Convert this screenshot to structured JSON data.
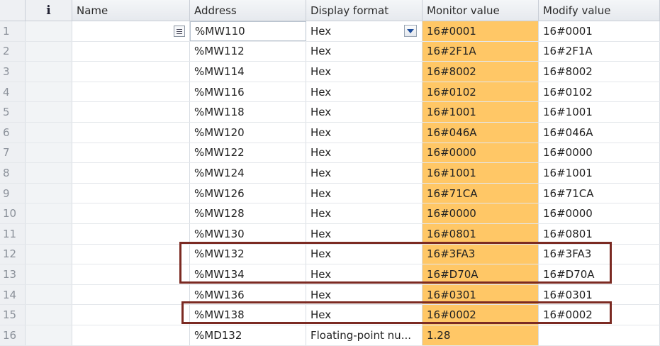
{
  "columns": {
    "info": "i",
    "name": "Name",
    "address": "Address",
    "display_format": "Display format",
    "monitor_value": "Monitor value",
    "modify_value": "Modify value"
  },
  "rows": [
    {
      "num": "1",
      "name": "",
      "address": "%MW110",
      "format": "Hex",
      "monitor": "16#0001",
      "modify": "16#0001"
    },
    {
      "num": "2",
      "name": "",
      "address": "%MW112",
      "format": "Hex",
      "monitor": "16#2F1A",
      "modify": "16#2F1A"
    },
    {
      "num": "3",
      "name": "",
      "address": "%MW114",
      "format": "Hex",
      "monitor": "16#8002",
      "modify": "16#8002"
    },
    {
      "num": "4",
      "name": "",
      "address": "%MW116",
      "format": "Hex",
      "monitor": "16#0102",
      "modify": "16#0102"
    },
    {
      "num": "5",
      "name": "",
      "address": "%MW118",
      "format": "Hex",
      "monitor": "16#1001",
      "modify": "16#1001"
    },
    {
      "num": "6",
      "name": "",
      "address": "%MW120",
      "format": "Hex",
      "monitor": "16#046A",
      "modify": "16#046A"
    },
    {
      "num": "7",
      "name": "",
      "address": "%MW122",
      "format": "Hex",
      "monitor": "16#0000",
      "modify": "16#0000"
    },
    {
      "num": "8",
      "name": "",
      "address": "%MW124",
      "format": "Hex",
      "monitor": "16#1001",
      "modify": "16#1001"
    },
    {
      "num": "9",
      "name": "",
      "address": "%MW126",
      "format": "Hex",
      "monitor": "16#71CA",
      "modify": "16#71CA"
    },
    {
      "num": "10",
      "name": "",
      "address": "%MW128",
      "format": "Hex",
      "monitor": "16#0000",
      "modify": "16#0000"
    },
    {
      "num": "11",
      "name": "",
      "address": "%MW130",
      "format": "Hex",
      "monitor": "16#0801",
      "modify": "16#0801"
    },
    {
      "num": "12",
      "name": "",
      "address": "%MW132",
      "format": "Hex",
      "monitor": "16#3FA3",
      "modify": "16#3FA3"
    },
    {
      "num": "13",
      "name": "",
      "address": "%MW134",
      "format": "Hex",
      "monitor": "16#D70A",
      "modify": "16#D70A"
    },
    {
      "num": "14",
      "name": "",
      "address": "%MW136",
      "format": "Hex",
      "monitor": "16#0301",
      "modify": "16#0301"
    },
    {
      "num": "15",
      "name": "",
      "address": "%MW138",
      "format": "Hex",
      "monitor": "16#0002",
      "modify": "16#0002"
    },
    {
      "num": "16",
      "name": "",
      "address": "%MD132",
      "format": "Floating-point nu...",
      "monitor": "1.28",
      "modify": ""
    }
  ],
  "colors": {
    "monitor_bg": "#ffc766",
    "highlight_border": "#7b2a22",
    "dropdown_arrow": "#1f4e9c"
  },
  "icons": {
    "info": "info-icon",
    "list": "list-icon",
    "dropdown": "chevron-down-icon"
  }
}
